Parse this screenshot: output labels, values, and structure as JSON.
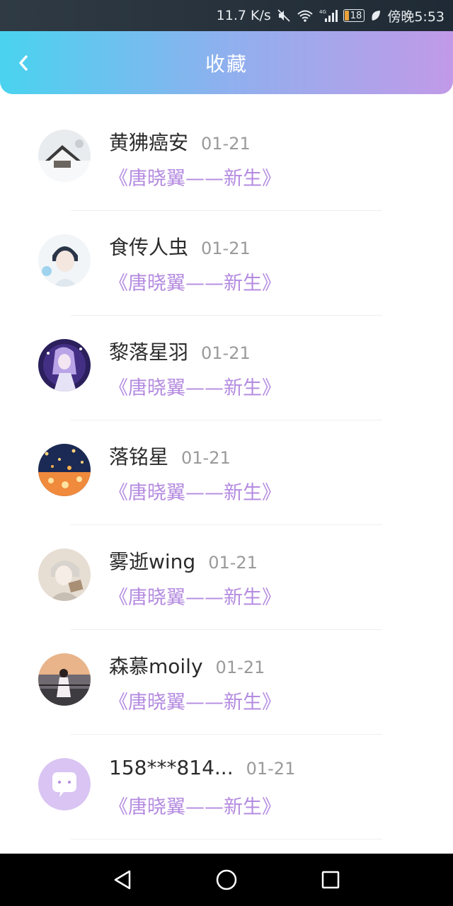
{
  "status_bar": {
    "speed": "11.7 K/s",
    "battery": "18",
    "time": "傍晚5:53"
  },
  "header": {
    "title": "收藏"
  },
  "items": [
    {
      "name": "黄狒癌安",
      "date": "01-21",
      "work": "《唐晓翼——新生》",
      "avatar": "avatar-snow-house"
    },
    {
      "name": "食传人虫",
      "date": "01-21",
      "work": "《唐晓翼——新生》",
      "avatar": "avatar-anime-boy"
    },
    {
      "name": "黎落星羽",
      "date": "01-21",
      "work": "《唐晓翼——新生》",
      "avatar": "avatar-anime-girl-purple"
    },
    {
      "name": "落铭星",
      "date": "01-21",
      "work": "《唐晓翼——新生》",
      "avatar": "avatar-lanterns-night"
    },
    {
      "name": "雾逝wing",
      "date": "01-21",
      "work": "《唐晓翼——新生》",
      "avatar": "avatar-anime-boy-light"
    },
    {
      "name": "森慕moily",
      "date": "01-21",
      "work": "《唐晓翼——新生》",
      "avatar": "avatar-girl-sunset"
    },
    {
      "name": "158***814...",
      "date": "01-21",
      "work": "《唐晓翼——新生》",
      "avatar": "default-chat-avatar"
    }
  ],
  "colors": {
    "accent_purple": "#b48be0",
    "header_gradient_start": "#49d3ef",
    "header_gradient_end": "#c19ae8"
  }
}
